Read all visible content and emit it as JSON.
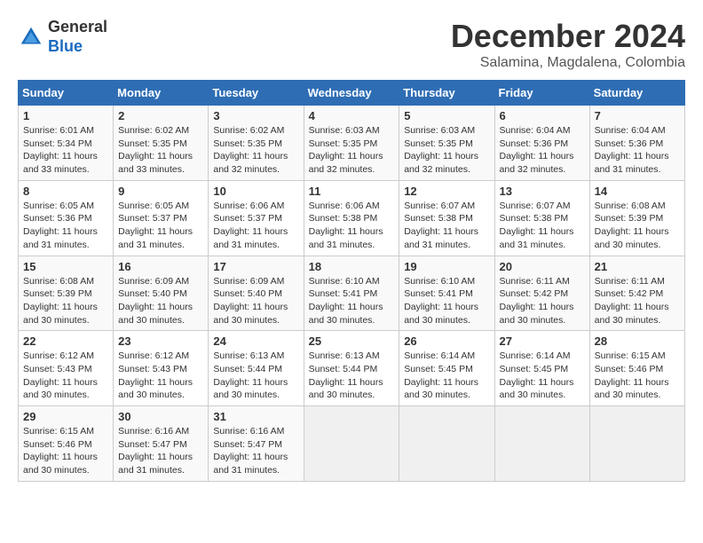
{
  "logo": {
    "general": "General",
    "blue": "Blue"
  },
  "header": {
    "month": "December 2024",
    "location": "Salamina, Magdalena, Colombia"
  },
  "weekdays": [
    "Sunday",
    "Monday",
    "Tuesday",
    "Wednesday",
    "Thursday",
    "Friday",
    "Saturday"
  ],
  "weeks": [
    [
      {
        "day": "1",
        "info": "Sunrise: 6:01 AM\nSunset: 5:34 PM\nDaylight: 11 hours\nand 33 minutes."
      },
      {
        "day": "2",
        "info": "Sunrise: 6:02 AM\nSunset: 5:35 PM\nDaylight: 11 hours\nand 33 minutes."
      },
      {
        "day": "3",
        "info": "Sunrise: 6:02 AM\nSunset: 5:35 PM\nDaylight: 11 hours\nand 32 minutes."
      },
      {
        "day": "4",
        "info": "Sunrise: 6:03 AM\nSunset: 5:35 PM\nDaylight: 11 hours\nand 32 minutes."
      },
      {
        "day": "5",
        "info": "Sunrise: 6:03 AM\nSunset: 5:35 PM\nDaylight: 11 hours\nand 32 minutes."
      },
      {
        "day": "6",
        "info": "Sunrise: 6:04 AM\nSunset: 5:36 PM\nDaylight: 11 hours\nand 32 minutes."
      },
      {
        "day": "7",
        "info": "Sunrise: 6:04 AM\nSunset: 5:36 PM\nDaylight: 11 hours\nand 31 minutes."
      }
    ],
    [
      {
        "day": "8",
        "info": "Sunrise: 6:05 AM\nSunset: 5:36 PM\nDaylight: 11 hours\nand 31 minutes."
      },
      {
        "day": "9",
        "info": "Sunrise: 6:05 AM\nSunset: 5:37 PM\nDaylight: 11 hours\nand 31 minutes."
      },
      {
        "day": "10",
        "info": "Sunrise: 6:06 AM\nSunset: 5:37 PM\nDaylight: 11 hours\nand 31 minutes."
      },
      {
        "day": "11",
        "info": "Sunrise: 6:06 AM\nSunset: 5:38 PM\nDaylight: 11 hours\nand 31 minutes."
      },
      {
        "day": "12",
        "info": "Sunrise: 6:07 AM\nSunset: 5:38 PM\nDaylight: 11 hours\nand 31 minutes."
      },
      {
        "day": "13",
        "info": "Sunrise: 6:07 AM\nSunset: 5:38 PM\nDaylight: 11 hours\nand 31 minutes."
      },
      {
        "day": "14",
        "info": "Sunrise: 6:08 AM\nSunset: 5:39 PM\nDaylight: 11 hours\nand 30 minutes."
      }
    ],
    [
      {
        "day": "15",
        "info": "Sunrise: 6:08 AM\nSunset: 5:39 PM\nDaylight: 11 hours\nand 30 minutes."
      },
      {
        "day": "16",
        "info": "Sunrise: 6:09 AM\nSunset: 5:40 PM\nDaylight: 11 hours\nand 30 minutes."
      },
      {
        "day": "17",
        "info": "Sunrise: 6:09 AM\nSunset: 5:40 PM\nDaylight: 11 hours\nand 30 minutes."
      },
      {
        "day": "18",
        "info": "Sunrise: 6:10 AM\nSunset: 5:41 PM\nDaylight: 11 hours\nand 30 minutes."
      },
      {
        "day": "19",
        "info": "Sunrise: 6:10 AM\nSunset: 5:41 PM\nDaylight: 11 hours\nand 30 minutes."
      },
      {
        "day": "20",
        "info": "Sunrise: 6:11 AM\nSunset: 5:42 PM\nDaylight: 11 hours\nand 30 minutes."
      },
      {
        "day": "21",
        "info": "Sunrise: 6:11 AM\nSunset: 5:42 PM\nDaylight: 11 hours\nand 30 minutes."
      }
    ],
    [
      {
        "day": "22",
        "info": "Sunrise: 6:12 AM\nSunset: 5:43 PM\nDaylight: 11 hours\nand 30 minutes."
      },
      {
        "day": "23",
        "info": "Sunrise: 6:12 AM\nSunset: 5:43 PM\nDaylight: 11 hours\nand 30 minutes."
      },
      {
        "day": "24",
        "info": "Sunrise: 6:13 AM\nSunset: 5:44 PM\nDaylight: 11 hours\nand 30 minutes."
      },
      {
        "day": "25",
        "info": "Sunrise: 6:13 AM\nSunset: 5:44 PM\nDaylight: 11 hours\nand 30 minutes."
      },
      {
        "day": "26",
        "info": "Sunrise: 6:14 AM\nSunset: 5:45 PM\nDaylight: 11 hours\nand 30 minutes."
      },
      {
        "day": "27",
        "info": "Sunrise: 6:14 AM\nSunset: 5:45 PM\nDaylight: 11 hours\nand 30 minutes."
      },
      {
        "day": "28",
        "info": "Sunrise: 6:15 AM\nSunset: 5:46 PM\nDaylight: 11 hours\nand 30 minutes."
      }
    ],
    [
      {
        "day": "29",
        "info": "Sunrise: 6:15 AM\nSunset: 5:46 PM\nDaylight: 11 hours\nand 30 minutes."
      },
      {
        "day": "30",
        "info": "Sunrise: 6:16 AM\nSunset: 5:47 PM\nDaylight: 11 hours\nand 31 minutes."
      },
      {
        "day": "31",
        "info": "Sunrise: 6:16 AM\nSunset: 5:47 PM\nDaylight: 11 hours\nand 31 minutes."
      },
      {
        "day": "",
        "info": ""
      },
      {
        "day": "",
        "info": ""
      },
      {
        "day": "",
        "info": ""
      },
      {
        "day": "",
        "info": ""
      }
    ]
  ]
}
